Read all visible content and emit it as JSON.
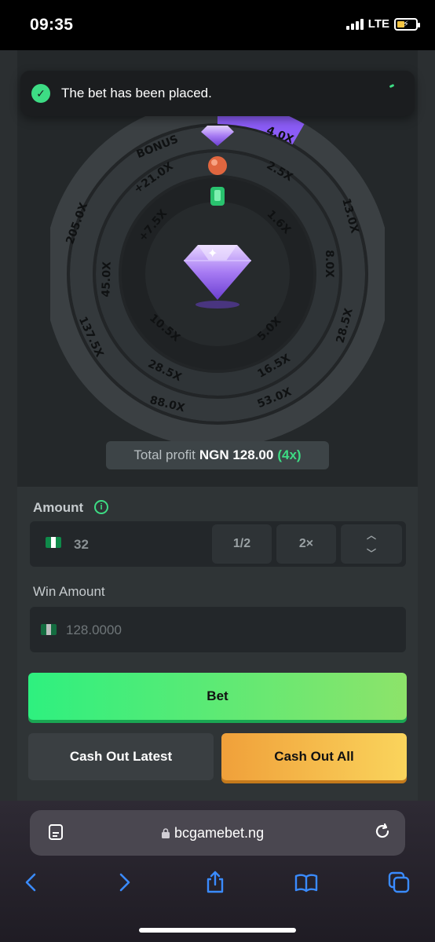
{
  "status_bar": {
    "time": "09:35",
    "network": "LTE"
  },
  "toast": {
    "message": "The bet has been placed."
  },
  "wheel": {
    "outer_ring": [
      "4.0X",
      "13.0X",
      "28.5X",
      "53.0X",
      "88.0X",
      "137.5X",
      "205.0X",
      "BONUS"
    ],
    "middle_ring": [
      "2.5X",
      "8.0X",
      "16.5X",
      "28.5X",
      "45.0X",
      "+21.0X"
    ],
    "inner_ring": [
      "1.6X",
      "5.0X",
      "10.5X",
      "+7.5X"
    ],
    "center_icon": "diamond-icon"
  },
  "profit": {
    "label": "Total profit",
    "amount": "NGN 128.00",
    "multiplier": "(4x)"
  },
  "amount": {
    "label": "Amount",
    "value": "32",
    "half_label": "1/2",
    "double_label": "2×"
  },
  "win_amount": {
    "label": "Win Amount",
    "value": "128.0000"
  },
  "buttons": {
    "bet": "Bet",
    "cash_out_latest": "Cash Out Latest",
    "cash_out_all": "Cash Out All"
  },
  "browser": {
    "url": "bcgamebet.ng"
  },
  "colors": {
    "accent_green": "#3ddc84",
    "accent_purple": "#8b5cf6",
    "cash_out_orange": "#f0a03a"
  }
}
